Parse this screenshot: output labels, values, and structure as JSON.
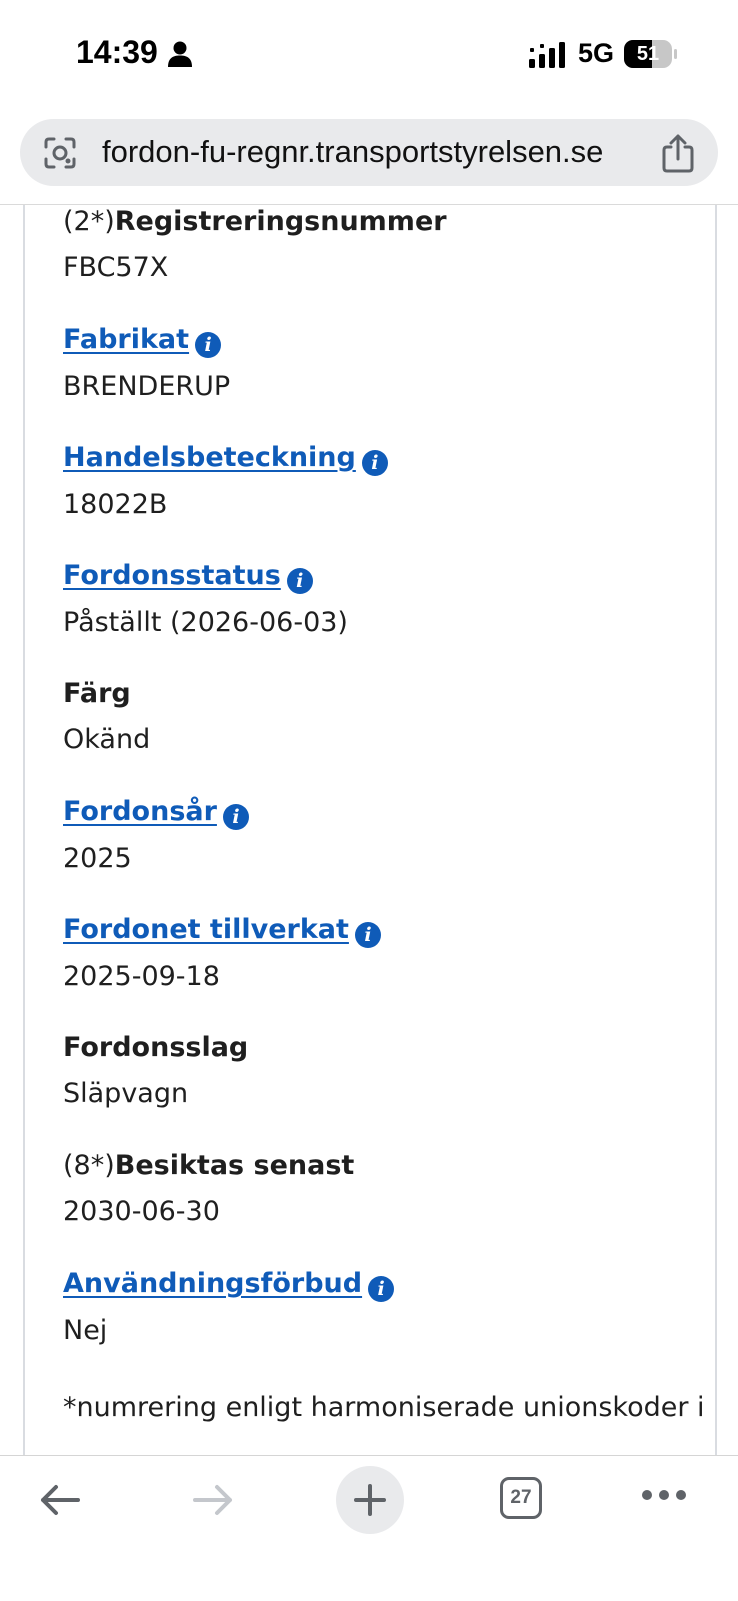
{
  "status_bar": {
    "time": "14:39",
    "network": "5G",
    "battery": "51"
  },
  "browser": {
    "url": "fordon-fu-regnr.transportstyrelsen.se",
    "tab_count": "27"
  },
  "fields": [
    {
      "prefix": "(2*)",
      "label": "Registreringsnummer",
      "link": false,
      "info": false,
      "value": "FBC57X"
    },
    {
      "prefix": "",
      "label": "Fabrikat",
      "link": true,
      "info": true,
      "value": "BRENDERUP"
    },
    {
      "prefix": "",
      "label": "Handelsbeteckning",
      "link": true,
      "info": true,
      "value": "18022B"
    },
    {
      "prefix": "",
      "label": "Fordonsstatus",
      "link": true,
      "info": true,
      "value": "Påställt (2026-06-03)"
    },
    {
      "prefix": "",
      "label": "Färg",
      "link": false,
      "info": false,
      "value": "Okänd"
    },
    {
      "prefix": "",
      "label": "Fordonsår",
      "link": true,
      "info": true,
      "value": "2025"
    },
    {
      "prefix": "",
      "label": "Fordonet tillverkat",
      "link": true,
      "info": true,
      "value": "2025-09-18"
    },
    {
      "prefix": "",
      "label": "Fordonsslag",
      "link": false,
      "info": false,
      "value": "Släpvagn"
    },
    {
      "prefix": "(8*)",
      "label": "Besiktas senast",
      "link": false,
      "info": false,
      "value": "2030-06-30"
    },
    {
      "prefix": "",
      "label": "Användningsförbud",
      "link": true,
      "info": true,
      "value": "Nej"
    }
  ],
  "footnote": "*numrering enligt harmoniserade unionskoder i",
  "info_glyph": "i",
  "icons": {
    "person": "person-icon",
    "signal": "signal-icon",
    "battery": "battery-icon",
    "lens": "lens-icon",
    "share": "share-icon",
    "back": "arrow-left-icon",
    "forward": "arrow-right-icon",
    "new_tab": "plus-icon",
    "tabs": "tabs-icon",
    "more": "more-icon"
  },
  "colors": {
    "link": "#0f5bb8",
    "text": "#1f1f1f",
    "url_bar_bg": "#e9eaec"
  }
}
